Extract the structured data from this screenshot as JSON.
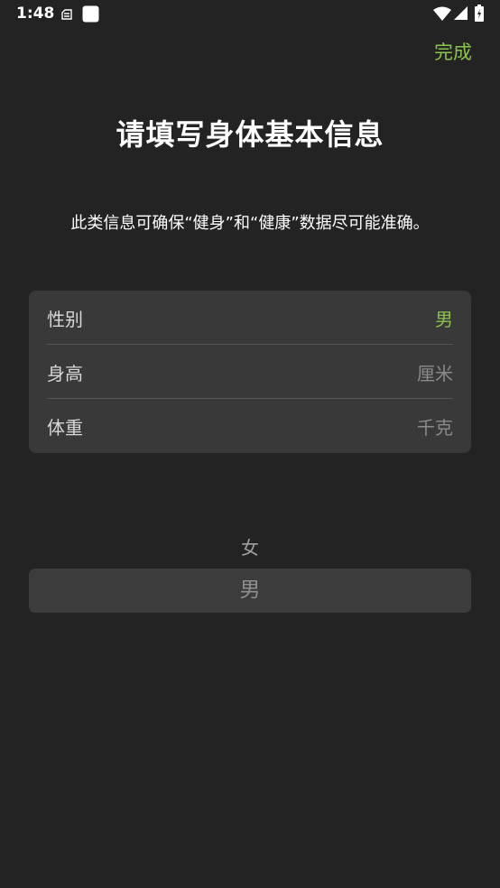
{
  "status_bar": {
    "time": "1:48"
  },
  "header": {
    "done_label": "完成"
  },
  "main": {
    "title": "请填写身体基本信息",
    "subtitle": "此类信息可确保“健身”和“健康”数据尽可能准确。"
  },
  "info_rows": [
    {
      "label": "性别",
      "value": "男"
    },
    {
      "label": "身高",
      "value": "厘米"
    },
    {
      "label": "体重",
      "value": "千克"
    }
  ],
  "picker": {
    "options": [
      "女",
      "男"
    ],
    "selected": "男"
  },
  "colors": {
    "background": "#232323",
    "card": "#393939",
    "accent": "#8bc34a"
  }
}
